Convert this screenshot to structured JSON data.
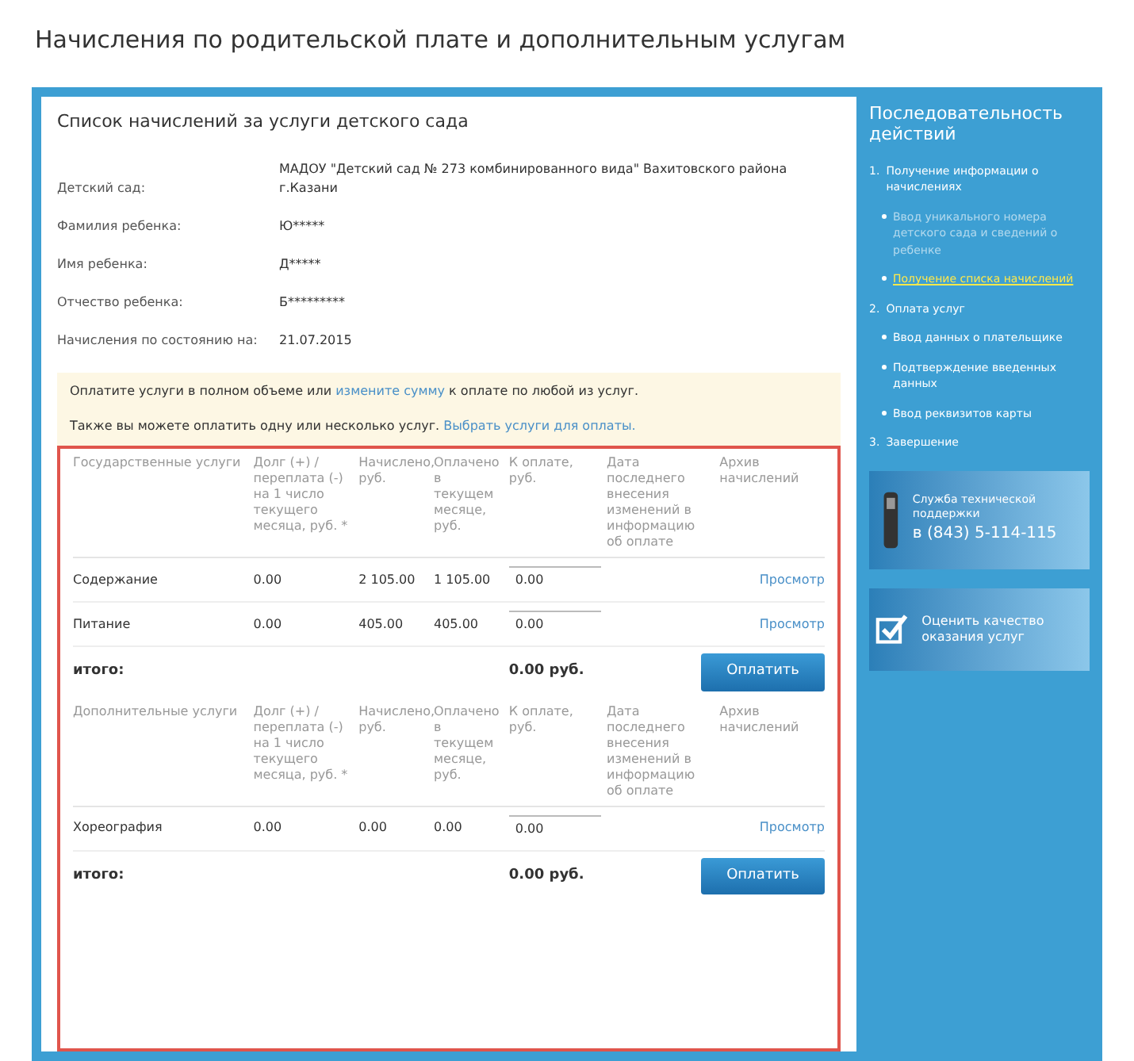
{
  "page_title": "Начисления по родительской плате и дополнительным услугам",
  "card": {
    "title": "Список начислений за услуги детского сада",
    "fields": [
      {
        "label": "Детский сад:",
        "value": "МАДОУ \"Детский сад № 273 комбинированного вида\" Вахитовского района г.Казани"
      },
      {
        "label": "Фамилия ребенка:",
        "value": "Ю*****"
      },
      {
        "label": "Имя ребенка:",
        "value": "Д*****"
      },
      {
        "label": "Отчество ребенка:",
        "value": "Б*********"
      },
      {
        "label": "Начисления по состоянию на:",
        "value": "21.07.2015"
      }
    ],
    "notice": [
      {
        "before": "Оплатите услуги в полном объеме или ",
        "link": "измените сумму",
        "after": " к оплате по любой из услуг."
      },
      {
        "before": "Также вы можете оплатить одну или несколько услуг. ",
        "link": "Выбрать услуги для оплаты."
      }
    ]
  },
  "tables": [
    {
      "columns": [
        "Государственные услуги",
        "Долг (+) / переплата (-) на 1 число текущего месяца, руб. *",
        "Начислено, руб.",
        "Оплачено в текущем месяце, руб.",
        "К оплате, руб.",
        "Дата последнего внесения изменений в информацию об оплате",
        "Архив начислений"
      ],
      "rows": [
        {
          "service": "Содержание",
          "debt": "0.00",
          "charged": "2 105.00",
          "paid": "1 105.00",
          "to_pay": "0.00",
          "archive": "Просмотр"
        },
        {
          "service": "Питание",
          "debt": "0.00",
          "charged": "405.00",
          "paid": "405.00",
          "to_pay": "0.00",
          "archive": "Просмотр"
        }
      ],
      "total_label": "итого:",
      "total": "0.00 руб.",
      "pay_button": "Оплатить"
    },
    {
      "columns": [
        "Дополнительные услуги",
        "Долг (+) / переплата (-) на 1 число текущего месяца, руб. *",
        "Начислено, руб.",
        "Оплачено в текущем месяце, руб.",
        "К оплате, руб.",
        "Дата последнего внесения изменений в информацию об оплате",
        "Архив начислений"
      ],
      "rows": [
        {
          "service": "Хореография",
          "debt": "0.00",
          "charged": "0.00",
          "paid": "0.00",
          "to_pay": "0.00",
          "archive": "Просмотр"
        }
      ],
      "total_label": "итого:",
      "total": "0.00 руб.",
      "pay_button": "Оплатить"
    }
  ],
  "sidebar": {
    "title": "Последовательность действий",
    "steps": [
      {
        "number": "1.",
        "label": "Получение информации о начислениях",
        "children": [
          {
            "label": "Ввод уникального номера детского сада и сведений о ребенке",
            "selected": false,
            "completed": true
          },
          {
            "label": "Получение списка начислений",
            "selected": true,
            "completed": false
          }
        ]
      },
      {
        "number": "2.",
        "label": "Оплата услуг",
        "children": [
          {
            "label": "Ввод данных о плательщике",
            "selected": false,
            "completed": false
          },
          {
            "label": "Подтверждение введенных данных",
            "selected": false,
            "completed": false
          },
          {
            "label": "Ввод реквизитов карты",
            "selected": false,
            "completed": false
          }
        ]
      },
      {
        "number": "3.",
        "label": "Завершение"
      }
    ],
    "support": {
      "text": "Служба технической поддержки",
      "phone": "в (843) 5-114-115"
    },
    "rating": {
      "text": "Оценить качество оказания услуг"
    }
  }
}
